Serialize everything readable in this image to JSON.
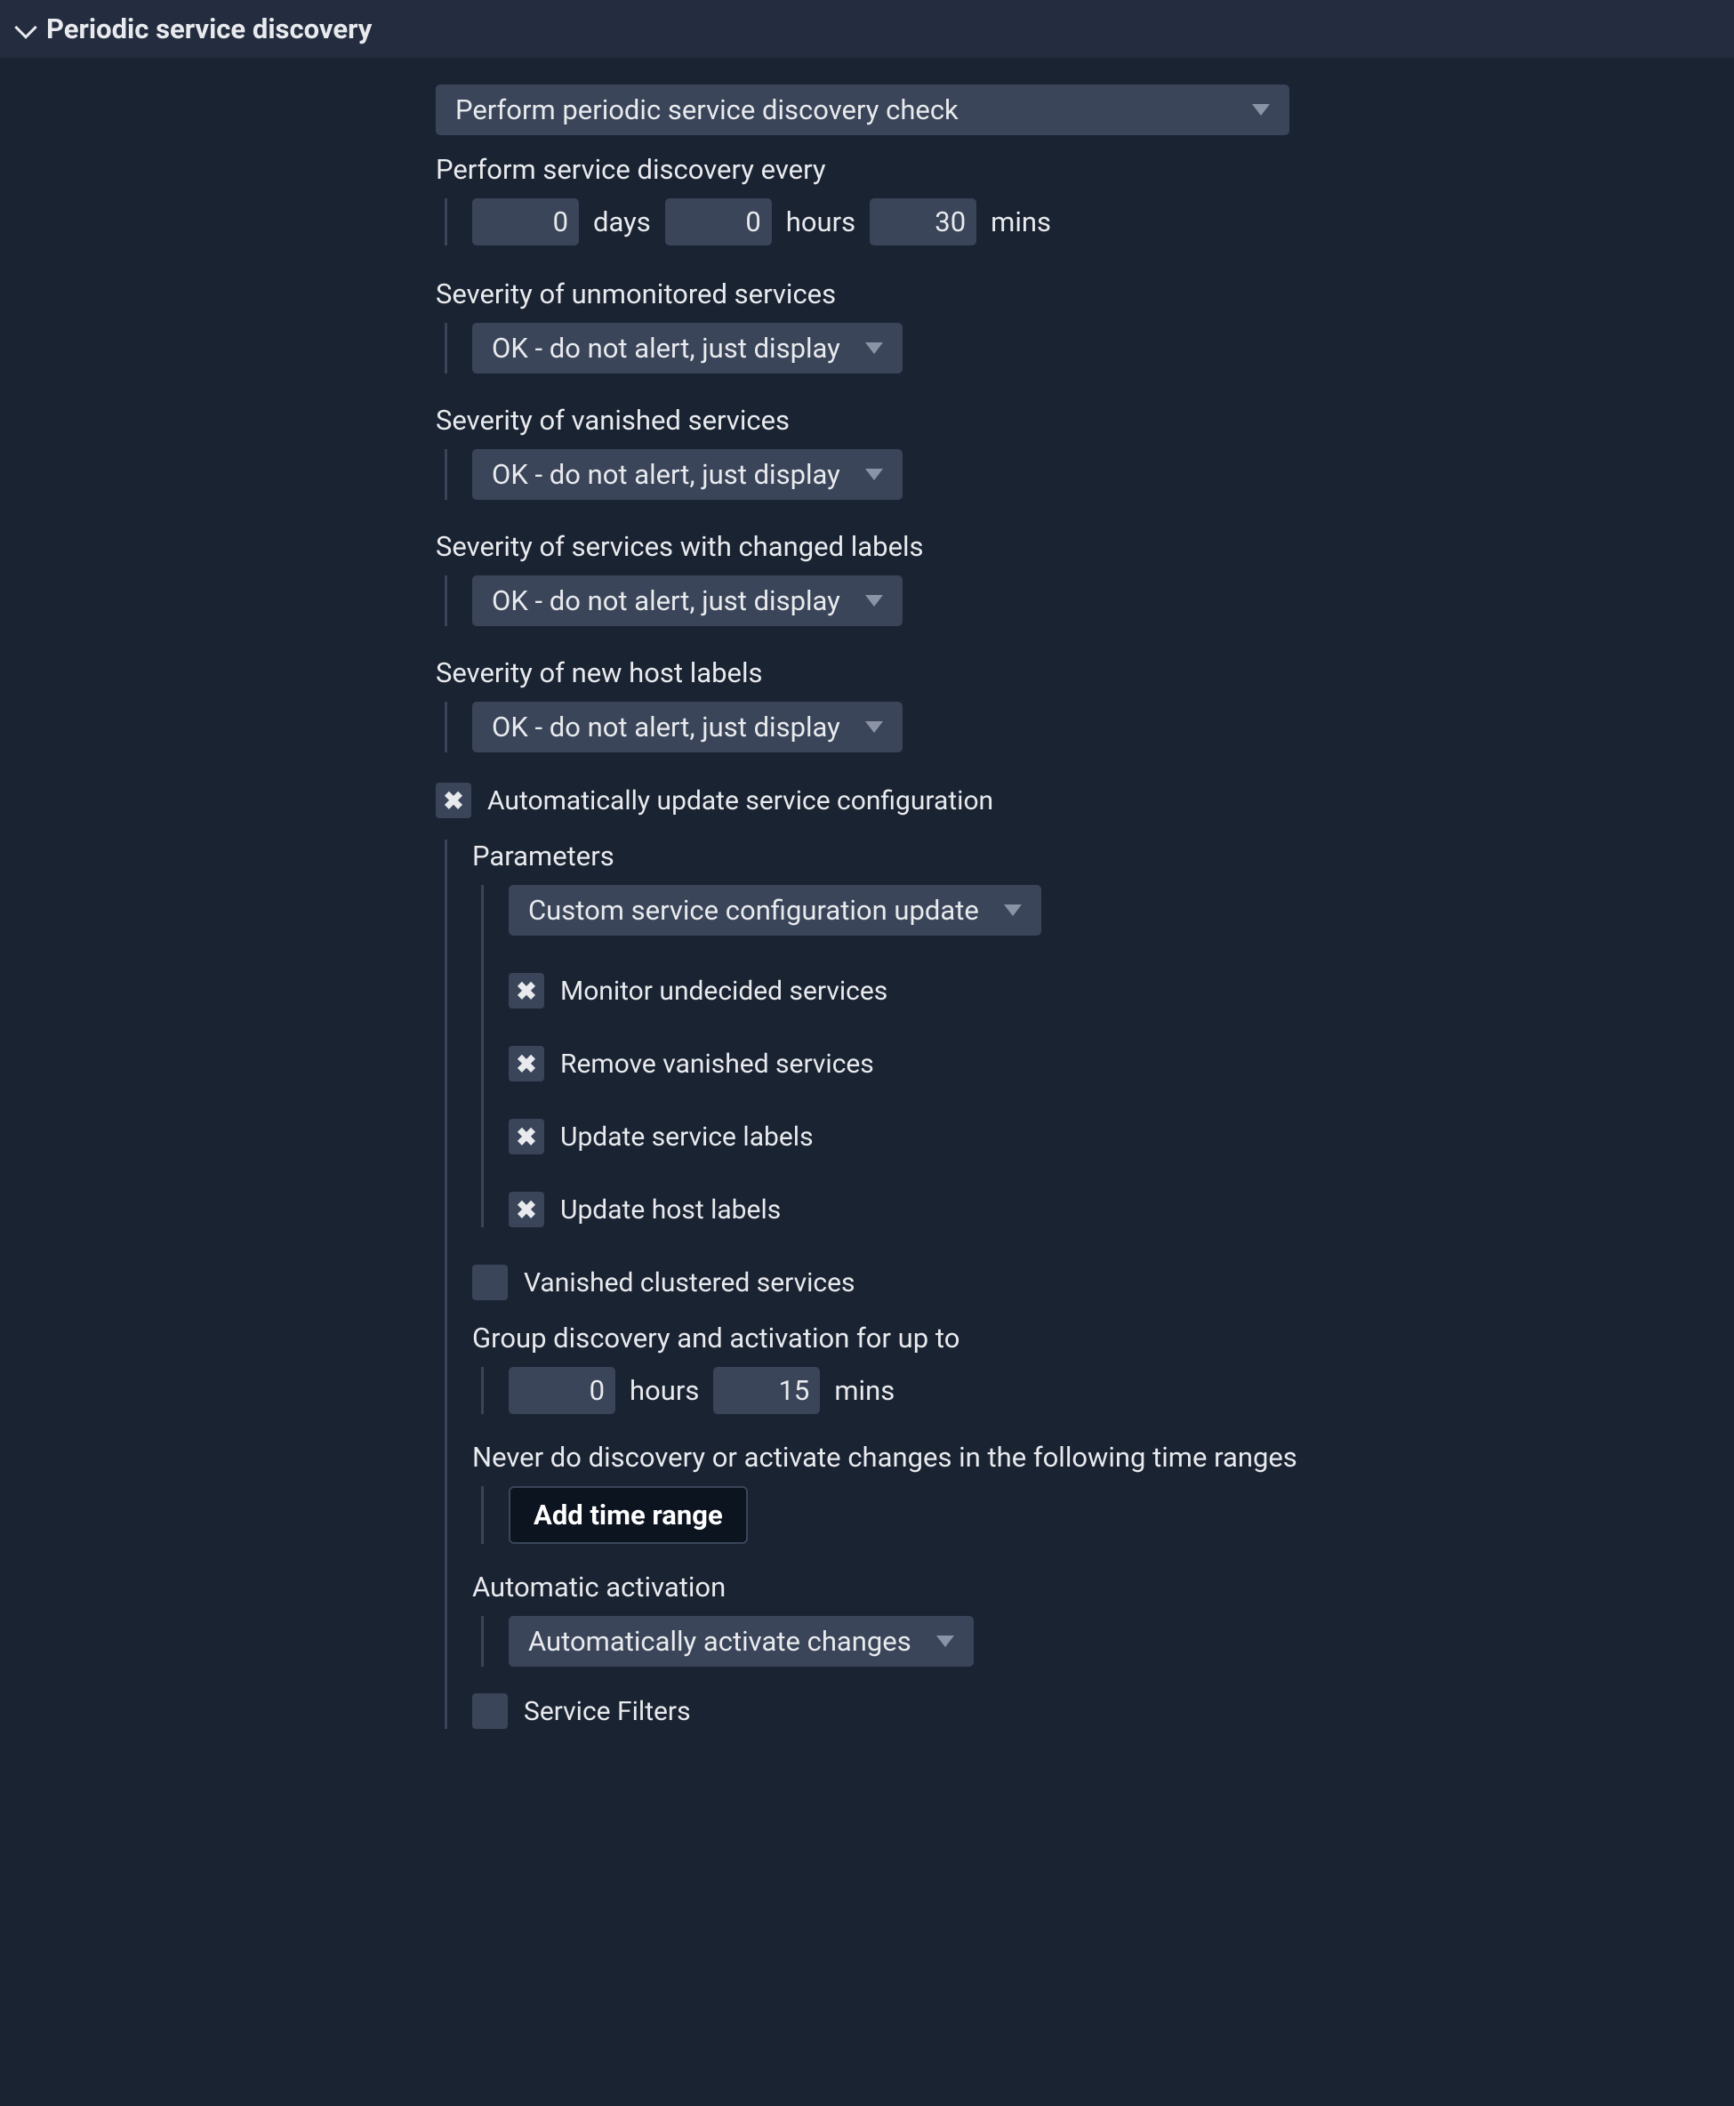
{
  "header": {
    "title": "Periodic service discovery"
  },
  "mode": {
    "label": "Perform periodic service discovery check"
  },
  "interval": {
    "label": "Perform service discovery every",
    "days": "0",
    "days_unit": "days",
    "hours": "0",
    "hours_unit": "hours",
    "mins": "30",
    "mins_unit": "mins"
  },
  "severity_unmonitored": {
    "label": "Severity of unmonitored services",
    "value": "OK - do not alert, just display"
  },
  "severity_vanished": {
    "label": "Severity of vanished services",
    "value": "OK - do not alert, just display"
  },
  "severity_changed_labels": {
    "label": "Severity of services with changed labels",
    "value": "OK - do not alert, just display"
  },
  "severity_new_host_labels": {
    "label": "Severity of new host labels",
    "value": "OK - do not alert, just display"
  },
  "auto_update": {
    "label": "Automatically update service configuration",
    "params_label": "Parameters",
    "mode": "Custom service configuration update",
    "monitor_undecided": "Monitor undecided services",
    "remove_vanished": "Remove vanished services",
    "update_service_labels": "Update service labels",
    "update_host_labels": "Update host labels",
    "vanished_clustered": "Vanished clustered services",
    "group_label": "Group discovery and activation for up to",
    "group_hours": "0",
    "group_hours_unit": "hours",
    "group_mins": "15",
    "group_mins_unit": "mins",
    "never_label": "Never do discovery or activate changes in the following time ranges",
    "add_time_range": "Add time range",
    "auto_activation_label": "Automatic activation",
    "auto_activation_value": "Automatically activate changes",
    "service_filters": "Service Filters"
  }
}
